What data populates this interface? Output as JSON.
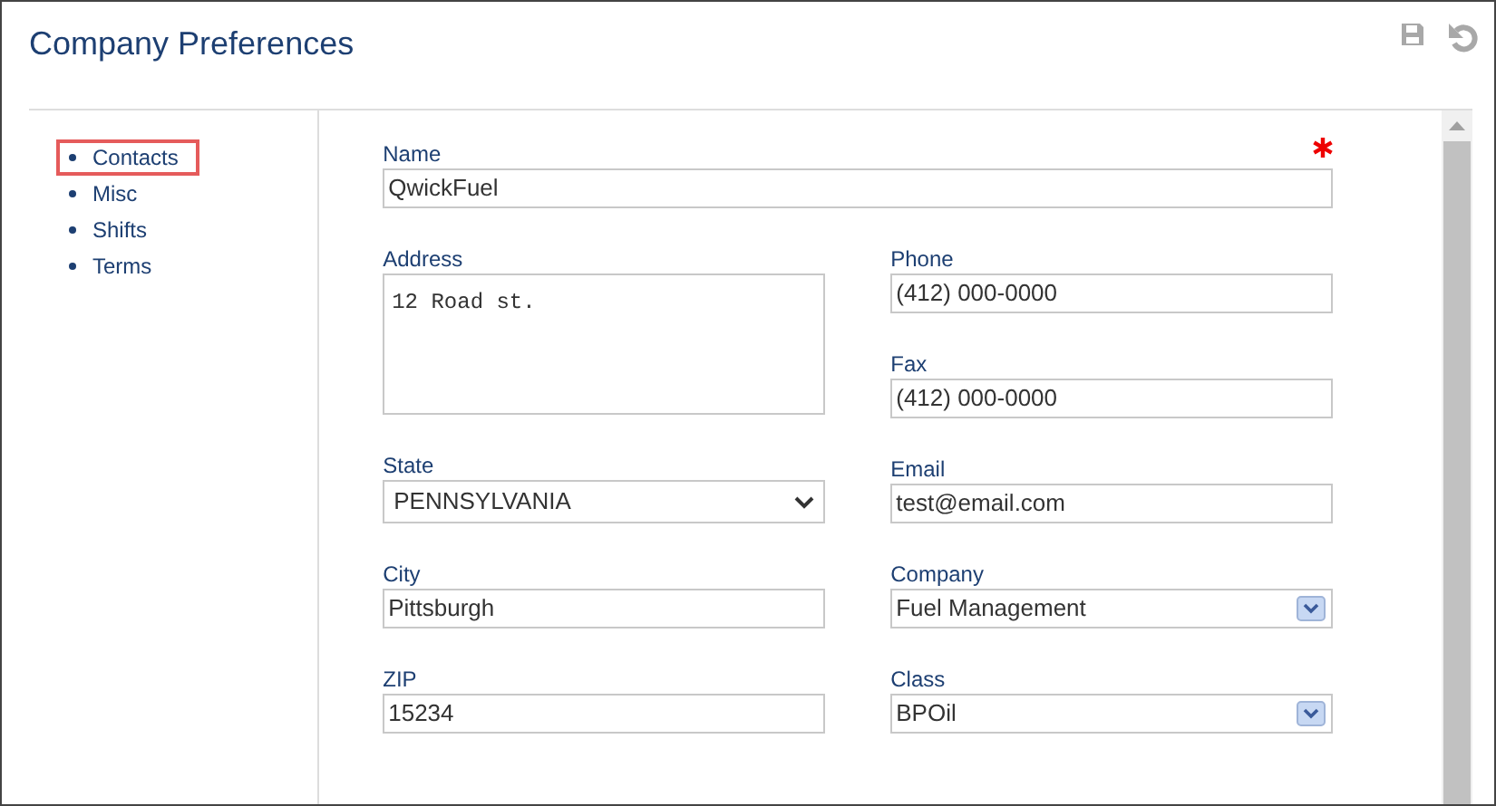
{
  "title": "Company Preferences",
  "nav": [
    {
      "label": "Contacts",
      "selected": true
    },
    {
      "label": "Misc",
      "selected": false
    },
    {
      "label": "Shifts",
      "selected": false
    },
    {
      "label": "Terms",
      "selected": false
    }
  ],
  "name_field": {
    "label": "Name",
    "value": "QwickFuel",
    "required": true
  },
  "left_fields": [
    {
      "kind": "textarea",
      "label": "Address",
      "value": "12 Road st."
    },
    {
      "kind": "select",
      "label": "State",
      "value": "PENNSYLVANIA"
    },
    {
      "kind": "text",
      "label": "City",
      "value": "Pittsburgh"
    },
    {
      "kind": "text",
      "label": "ZIP",
      "value": "15234"
    }
  ],
  "right_fields": [
    {
      "kind": "text",
      "label": "Phone",
      "value": "(412) 000-0000"
    },
    {
      "kind": "text",
      "label": "Fax",
      "value": "(412) 000-0000"
    },
    {
      "kind": "text",
      "label": "Email",
      "value": "test@email.com"
    },
    {
      "kind": "combo",
      "label": "Company",
      "value": "Fuel Management"
    },
    {
      "kind": "combo",
      "label": "Class",
      "value": "BPOil"
    }
  ]
}
